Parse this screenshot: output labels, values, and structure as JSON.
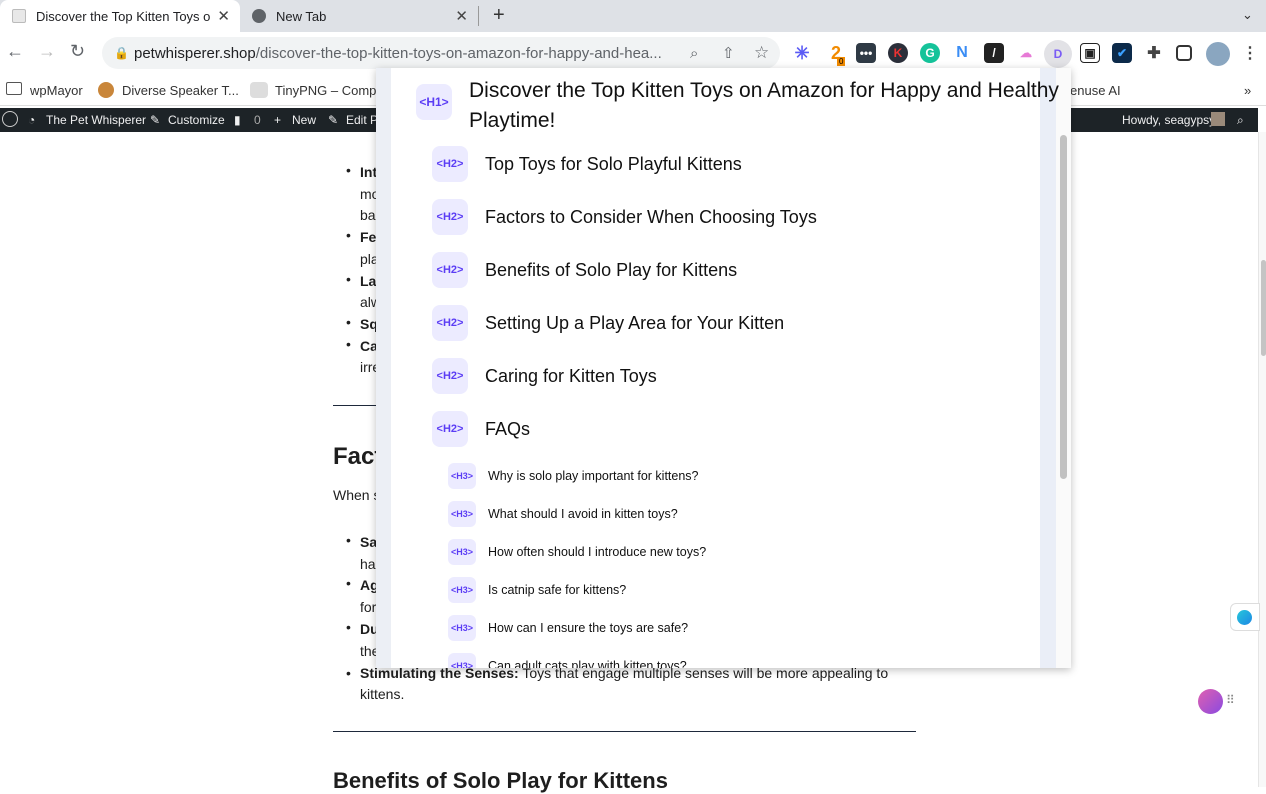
{
  "browser": {
    "tabs": [
      {
        "title": "Discover the Top Kitten Toys on Amazon for Happy and Healthy Playtime!",
        "display": "Discover the Top Kitten Toys o",
        "active": true
      },
      {
        "title": "New Tab",
        "active": false
      }
    ],
    "url_domain": "petwhisperer.shop",
    "url_path": "/discover-the-top-kitten-toys-on-amazon-for-happy-and-hea...",
    "bookmarks": [
      "wpMayor",
      "Diverse Speaker T...",
      "TinyPNG – Compr",
      "enuse AI"
    ],
    "more_bookmarks": "»",
    "ext_badge": "0"
  },
  "wpbar": {
    "site": "The Pet Whisperer",
    "customize": "Customize",
    "comments": "0",
    "new": "New",
    "edit": "Edit P",
    "howdy": "Howdy, seagypsy"
  },
  "page": {
    "list1": [
      {
        "b": "Int",
        "t": ""
      },
      {
        "b": "",
        "t": "mo"
      },
      {
        "b": "",
        "t": "ba"
      },
      {
        "b": "Fe",
        "t": ""
      },
      {
        "b": "",
        "t": "pla"
      },
      {
        "b": "La",
        "t": ""
      },
      {
        "b": "",
        "t": "alw"
      },
      {
        "b": "Sq",
        "t": ""
      },
      {
        "b": "Ca",
        "t": ""
      },
      {
        "b": "",
        "t": "irre"
      }
    ],
    "heading2": "Fact",
    "intro": "When s",
    "list2": [
      {
        "b": "Sa",
        "t": ""
      },
      {
        "b": "",
        "t": "ha"
      },
      {
        "b": "Ag",
        "t": ""
      },
      {
        "b": "",
        "t": "for"
      },
      {
        "b": "Du",
        "t": ""
      },
      {
        "b": "",
        "t": "the"
      }
    ],
    "stim_bold": "Stimulating the Senses:",
    "stim_text": " Toys that engage multiple senses will be more appealing to",
    "stim_text2": "kittens.",
    "heading3": "Benefits of Solo Play for Kittens"
  },
  "outline": {
    "h1": {
      "tag": "<H1>",
      "line1": "Discover the Top Kitten Toys on Amazon for Happy and Healthy",
      "line2": "Playtime!"
    },
    "h2": [
      {
        "tag": "<H2>",
        "text": "Top Toys for Solo Playful Kittens"
      },
      {
        "tag": "<H2>",
        "text": "Factors to Consider When Choosing Toys"
      },
      {
        "tag": "<H2>",
        "text": "Benefits of Solo Play for Kittens"
      },
      {
        "tag": "<H2>",
        "text": "Setting Up a Play Area for Your Kitten"
      },
      {
        "tag": "<H2>",
        "text": "Caring for Kitten Toys"
      },
      {
        "tag": "<H2>",
        "text": "FAQs"
      }
    ],
    "h3": [
      {
        "tag": "<H3>",
        "text": "Why is solo play important for kittens?"
      },
      {
        "tag": "<H3>",
        "text": "What should I avoid in kitten toys?"
      },
      {
        "tag": "<H3>",
        "text": "How often should I introduce new toys?"
      },
      {
        "tag": "<H3>",
        "text": "Is catnip safe for kittens?"
      },
      {
        "tag": "<H3>",
        "text": "How can I ensure the toys are safe?"
      },
      {
        "tag": "<H3>",
        "text": "Can adult cats play with kitten toys?"
      }
    ]
  }
}
